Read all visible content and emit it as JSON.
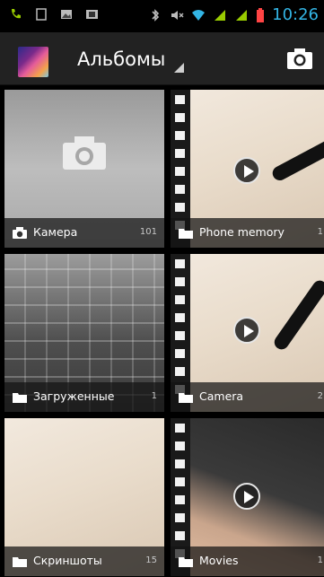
{
  "status_bar": {
    "time": "10:26"
  },
  "action_bar": {
    "title": "Альбомы"
  },
  "albums": [
    {
      "label": "Камера",
      "count": "101"
    },
    {
      "label": "Phone memory",
      "count": "1"
    },
    {
      "label": "Загруженные",
      "count": "1"
    },
    {
      "label": "Camera",
      "count": "2"
    },
    {
      "label": "Скриншоты",
      "count": "15"
    },
    {
      "label": "Movies",
      "count": "1"
    }
  ],
  "colors": {
    "accent": "#33b5e5",
    "signal": "#99cc00",
    "battery": "#ff4444"
  }
}
